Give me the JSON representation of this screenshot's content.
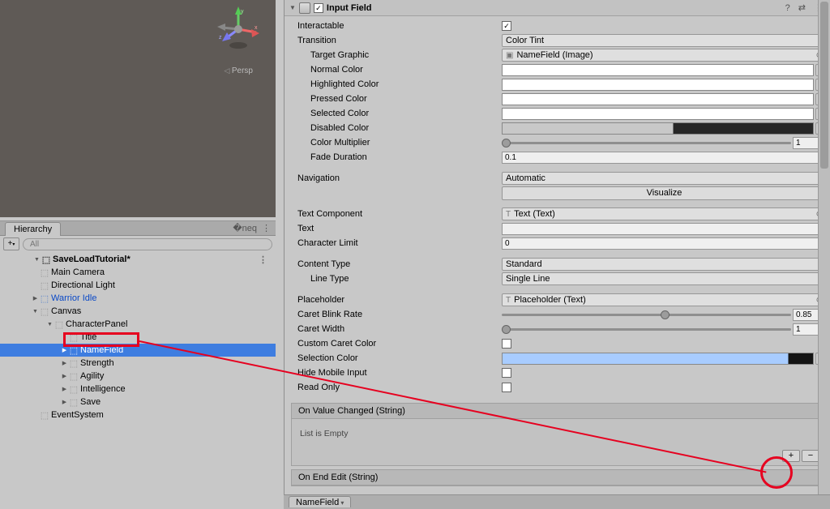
{
  "scene": {
    "persp_label": "Persp"
  },
  "hierarchy": {
    "tab": "Hierarchy",
    "search_placeholder": "All",
    "scene": "SaveLoadTutorial*",
    "items": {
      "main_camera": "Main Camera",
      "directional_light": "Directional Light",
      "warrior_idle": "Warrior Idle",
      "canvas": "Canvas",
      "character_panel": "CharacterPanel",
      "title": "Title",
      "name_field": "NameField",
      "strength": "Strength",
      "agility": "Agility",
      "intelligence": "Intelligence",
      "save": "Save",
      "event_system": "EventSystem"
    }
  },
  "inspector": {
    "component_title": "Input Field",
    "interactable": {
      "label": "Interactable",
      "checked": true
    },
    "transition": {
      "label": "Transition",
      "value": "Color Tint"
    },
    "target_graphic": {
      "label": "Target Graphic",
      "value": "NameField (Image)"
    },
    "normal_color": {
      "label": "Normal Color"
    },
    "highlighted_color": {
      "label": "Highlighted Color"
    },
    "pressed_color": {
      "label": "Pressed Color"
    },
    "selected_color": {
      "label": "Selected Color"
    },
    "disabled_color": {
      "label": "Disabled Color"
    },
    "color_multiplier": {
      "label": "Color Multiplier",
      "value": "1"
    },
    "fade_duration": {
      "label": "Fade Duration",
      "value": "0.1"
    },
    "navigation": {
      "label": "Navigation",
      "value": "Automatic"
    },
    "visualize_btn": "Visualize",
    "text_component": {
      "label": "Text Component",
      "value": "Text (Text)"
    },
    "text": {
      "label": "Text",
      "value": ""
    },
    "character_limit": {
      "label": "Character Limit",
      "value": "0"
    },
    "content_type": {
      "label": "Content Type",
      "value": "Standard"
    },
    "line_type": {
      "label": "Line Type",
      "value": "Single Line"
    },
    "placeholder": {
      "label": "Placeholder",
      "value": "Placeholder (Text)"
    },
    "caret_blink": {
      "label": "Caret Blink Rate",
      "value": "0.85"
    },
    "caret_width": {
      "label": "Caret Width",
      "value": "1"
    },
    "custom_caret": {
      "label": "Custom Caret Color"
    },
    "selection_color": {
      "label": "Selection Color"
    },
    "hide_mobile": {
      "label": "Hide Mobile Input"
    },
    "read_only": {
      "label": "Read Only"
    },
    "event_on_value": {
      "title": "On Value Changed (String)",
      "body": "List is Empty"
    },
    "event_on_end": {
      "title": "On End Edit (String)"
    }
  },
  "bottom_tab": "NameField"
}
